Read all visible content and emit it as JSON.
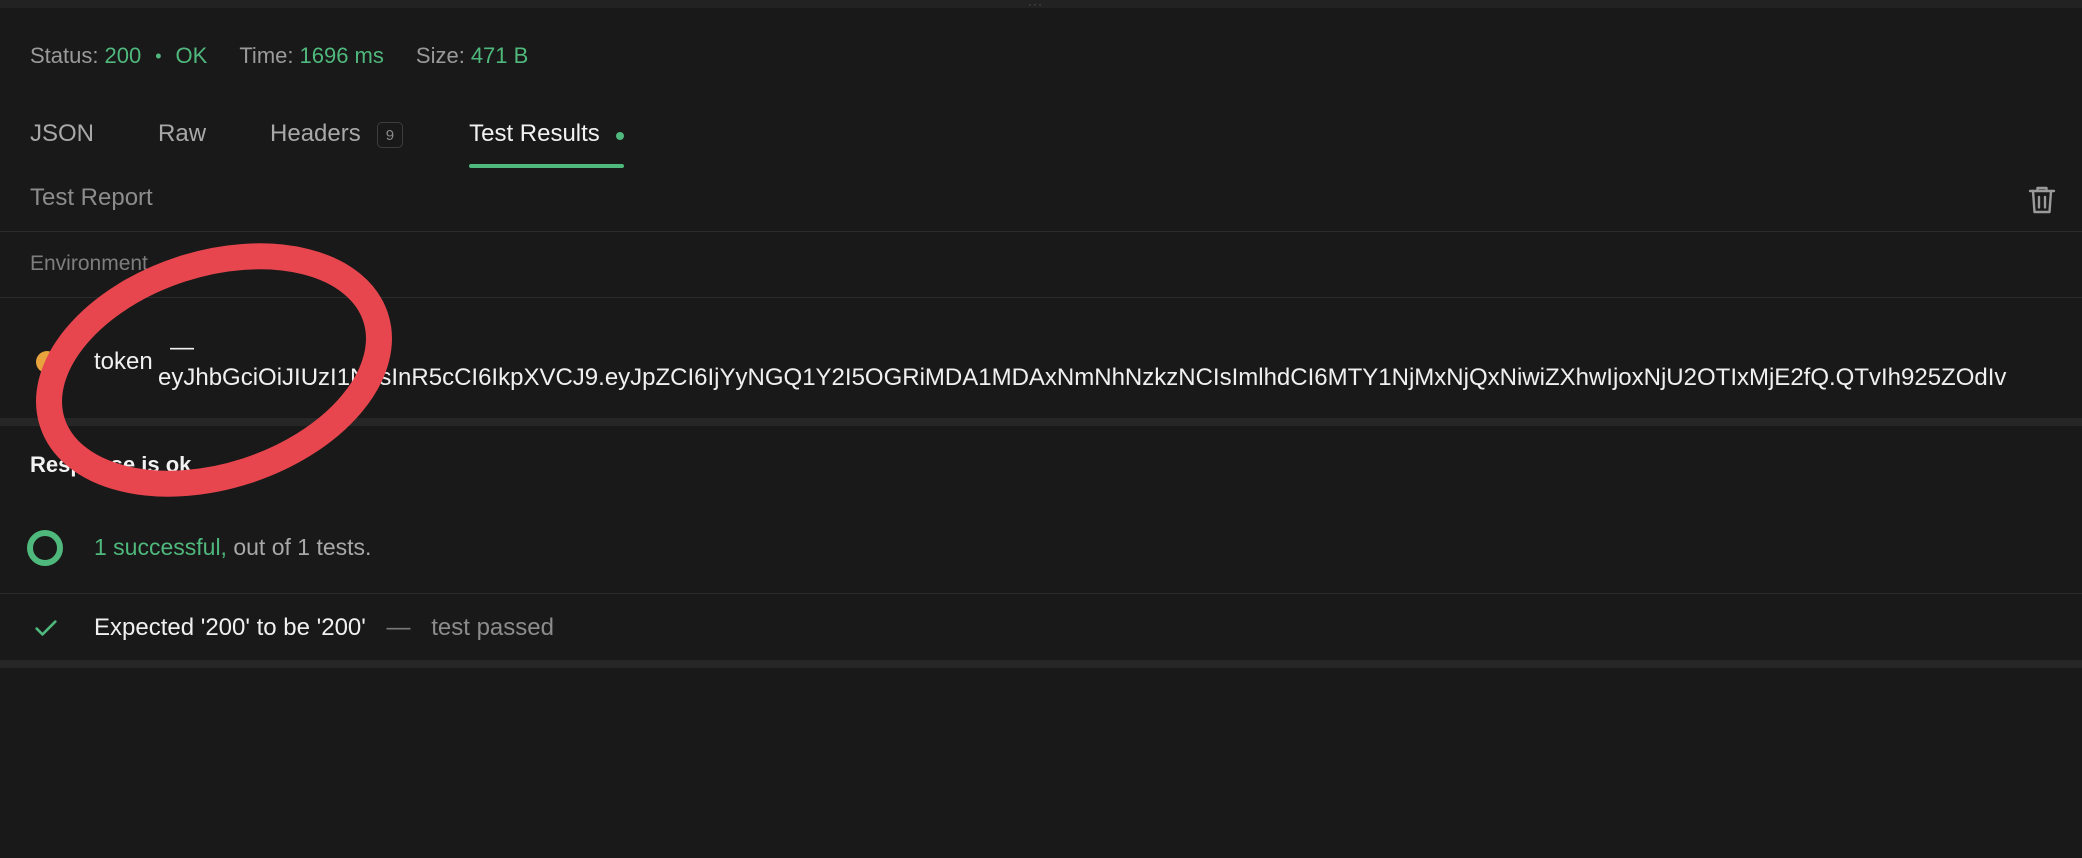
{
  "status": {
    "status_label": "Status:",
    "status_code": "200",
    "status_text": "OK",
    "time_label": "Time:",
    "time_value": "1696 ms",
    "size_label": "Size:",
    "size_value": "471 B"
  },
  "tabs": [
    {
      "label": "JSON"
    },
    {
      "label": "Raw"
    },
    {
      "label": "Headers",
      "badge": "9"
    },
    {
      "label": "Test Results"
    }
  ],
  "report": {
    "title": "Test Report",
    "clear_icon": "trash-icon"
  },
  "environment": {
    "title": "Environment",
    "variable": {
      "key": "token",
      "separator": "—",
      "value": "eyJhbGciOiJIUzI1NiIsInR5cCI6IkpXVCJ9.eyJpZCI6IjYyNGQ1Y2I5OGRiMDA1MDAxNmNhNzkzNCIsImlhdCI6MTY1NjMxNjQxNiwiZXhwIjoxNjU2OTIxMjE2fQ.QTvIh925ZOdIv"
    }
  },
  "tests": {
    "group_title": "Response is ok",
    "summary_success": "1 successful,",
    "summary_rest": "out of 1 tests.",
    "results": [
      {
        "expectation": "Expected '200' to be '200'",
        "separator": "—",
        "result": "test passed"
      }
    ]
  },
  "colors": {
    "success": "#4fb87c",
    "warning": "#e8a33c",
    "annotation": "#e8464e",
    "background": "#191919"
  }
}
